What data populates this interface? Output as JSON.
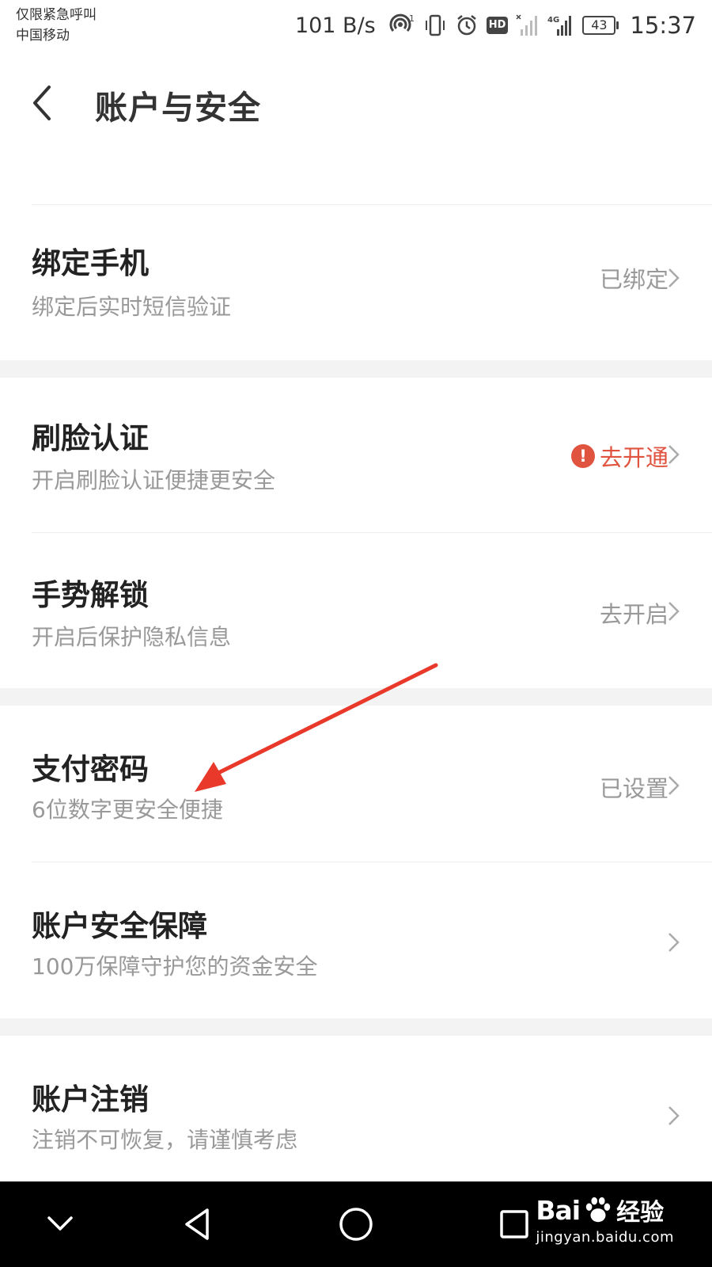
{
  "status_bar": {
    "carrier_line1": "仅限紧急呼叫",
    "carrier_line2": "中国移动",
    "net_speed": "101 B/s",
    "hotspot_sup": "1",
    "hd": "HD",
    "net_type": "4G",
    "battery": "43",
    "time": "15:37"
  },
  "header": {
    "title": "账户与安全"
  },
  "items": [
    {
      "title": "绑定手机",
      "subtitle": "绑定后实时短信验证",
      "status": "已绑定"
    },
    {
      "title": "刷脸认证",
      "subtitle": "开启刷脸认证便捷更安全",
      "status": "去开通",
      "status_color": "#e0533f",
      "warn": "!"
    },
    {
      "title": "手势解锁",
      "subtitle": "开启后保护隐私信息",
      "status": "去开启"
    },
    {
      "title": "支付密码",
      "subtitle": "6位数字更安全便捷",
      "status": "已设置"
    },
    {
      "title": "账户安全保障",
      "subtitle": "100万保障守护您的资金安全",
      "status": ""
    },
    {
      "title": "账户注销",
      "subtitle": "注销不可恢复，请谨慎考虑",
      "status": ""
    }
  ],
  "colors": {
    "accent": "#e0533f",
    "arrow": "#e8392b",
    "nav_bg": "#000000",
    "section_bg": "#f3f3f3"
  },
  "watermark": {
    "brand": "Bai",
    "brand_cn": "经验",
    "url": "jingyan.baidu.com"
  }
}
